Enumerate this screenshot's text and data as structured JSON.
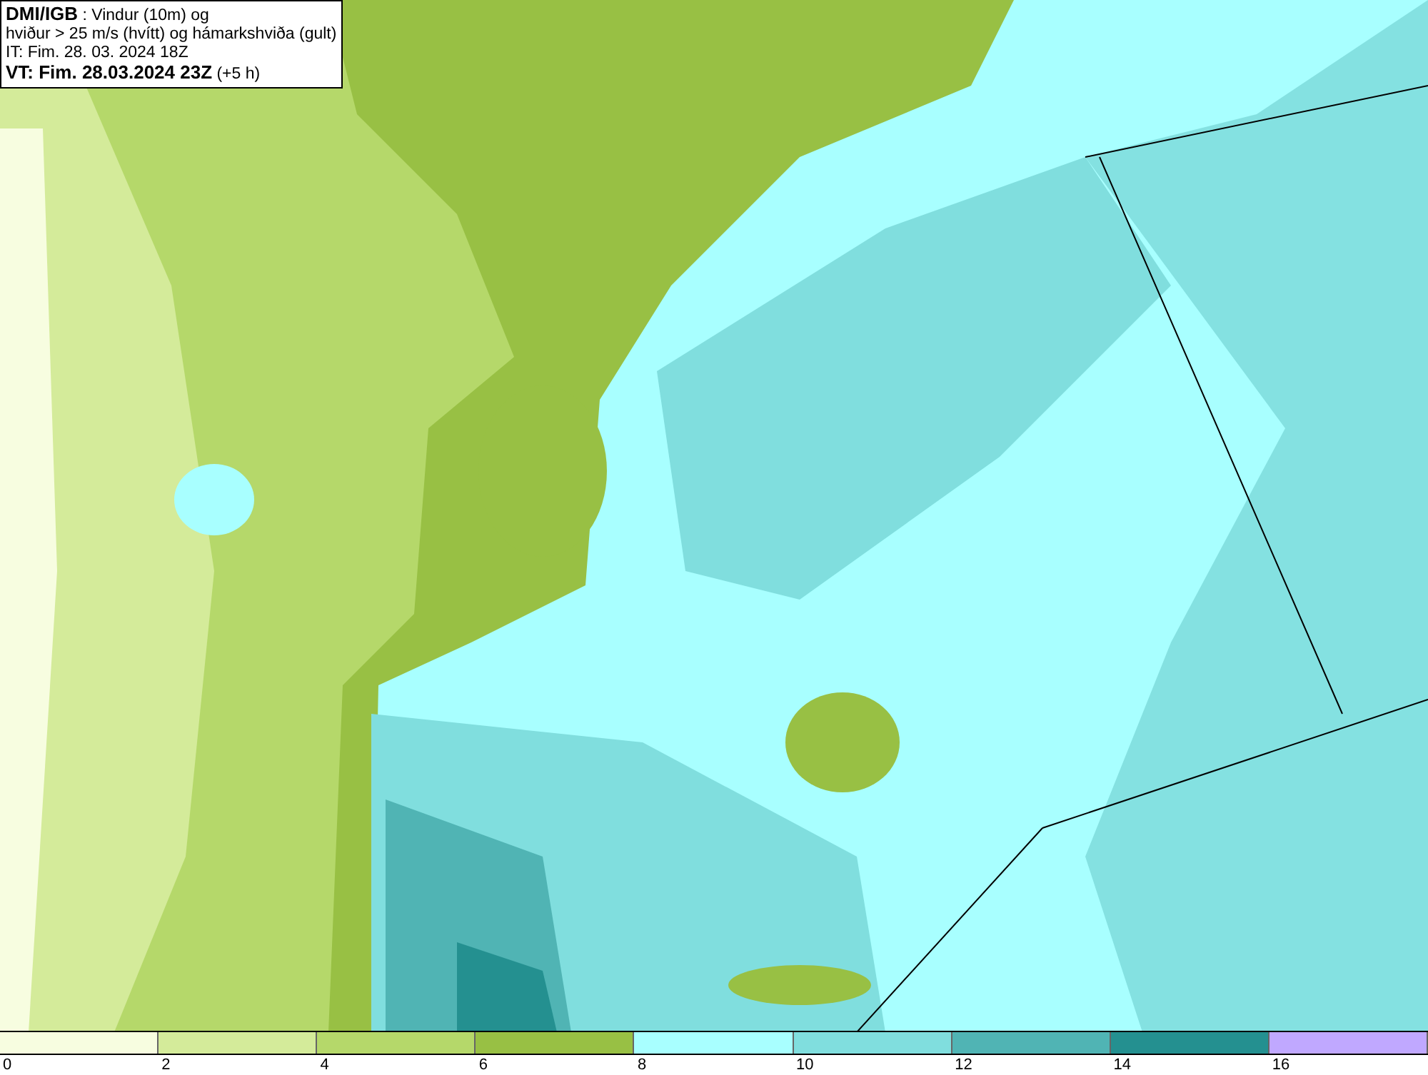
{
  "info_box": {
    "lines": [
      "**DMI/IGB** : Vindur (10m) og",
      "hviður > 25 m/s (hvítt) og hámarkshviða (gult)",
      "IT: Fim. 28. 03. 2024 18Z",
      "**VT: Fim. 28.03.2024 23Z** (+5 h)"
    ]
  },
  "legend": {
    "bins": [
      {
        "color": "#f7fde0"
      },
      {
        "color": "#d4eb9a"
      },
      {
        "color": "#b5d86a"
      },
      {
        "color": "#98c044"
      },
      {
        "color": "#a8ffff"
      },
      {
        "color": "#80dede"
      },
      {
        "color": "#50b4b4"
      },
      {
        "color": "#249090"
      },
      {
        "color": "#c0a8ff"
      }
    ],
    "ticks": [
      "0",
      "2",
      "4",
      "6",
      "8",
      "10",
      "12",
      "14",
      "16"
    ]
  }
}
